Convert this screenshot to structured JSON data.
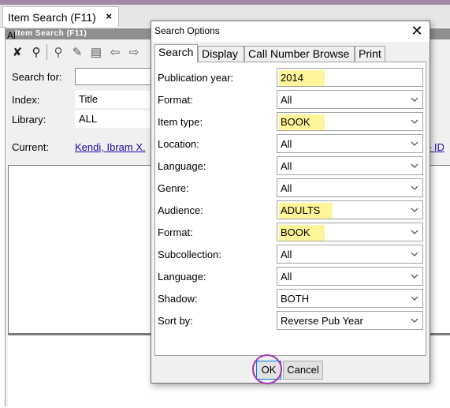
{
  "app": {
    "tab_label": "Item Search (F11)",
    "tab_close": "×",
    "subtitle": "Item Search (F11)",
    "al_text": "Al"
  },
  "form": {
    "search_for_label": "Search for:",
    "search_for_value": "",
    "index_label": "Index:",
    "index_value": "Title",
    "library_label": "Library:",
    "library_value": "ALL",
    "current_label": "Current:",
    "current_link": "Kendi, Ibram X.",
    "current_right": "– ID"
  },
  "dialog": {
    "title": "Search Options",
    "close": "✕",
    "tabs": [
      "Search",
      "Display",
      "Call Number Browse",
      "Print"
    ],
    "active_tab": "Search",
    "fields": [
      {
        "label": "Publication year:",
        "value": "2014",
        "highlight": true,
        "type": "text"
      },
      {
        "label": "Format:",
        "value": "All",
        "highlight": false,
        "type": "select"
      },
      {
        "label": "Item type:",
        "value": "BOOK",
        "highlight": true,
        "type": "select"
      },
      {
        "label": "Location:",
        "value": "All",
        "highlight": false,
        "type": "select"
      },
      {
        "label": "Language:",
        "value": "All",
        "highlight": false,
        "type": "select"
      },
      {
        "label": "Genre:",
        "value": "All",
        "highlight": false,
        "type": "select"
      },
      {
        "label": "Audience:",
        "value": "ADULTS",
        "highlight": true,
        "type": "select"
      },
      {
        "label": "Format:",
        "value": "BOOK",
        "highlight": true,
        "type": "select"
      },
      {
        "label": "Subcollection:",
        "value": "All",
        "highlight": false,
        "type": "select"
      },
      {
        "label": "Language:",
        "value": "All",
        "highlight": false,
        "type": "select"
      },
      {
        "label": "Shadow:",
        "value": "BOTH",
        "highlight": false,
        "type": "select"
      },
      {
        "label": "Sort by:",
        "value": "Reverse Pub Year",
        "highlight": false,
        "type": "select"
      }
    ],
    "ok_label": "OK",
    "cancel_label": "Cancel"
  },
  "colors": {
    "highlight": "#fff59a",
    "annotation_circle": "#a435b3",
    "link": "#1a0dab"
  }
}
